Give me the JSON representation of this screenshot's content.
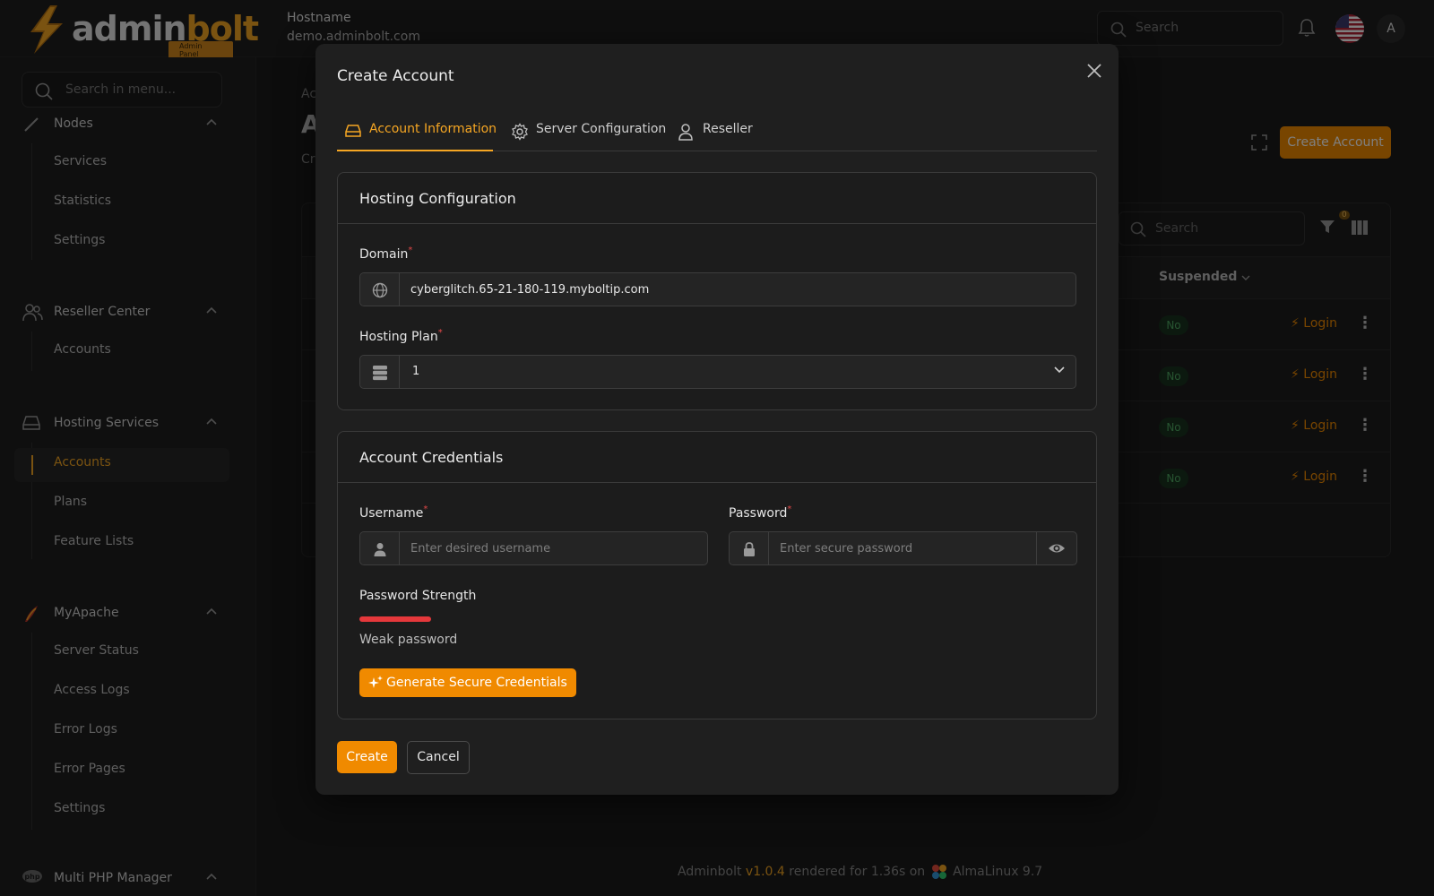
{
  "app": {
    "logo_admin": "admin",
    "logo_bolt": "bolt",
    "logo_badge": "Admin Panel",
    "hostname_label": "Hostname",
    "hostname_value": "demo.adminbolt.com",
    "search_placeholder": "Search",
    "avatar_initial": "A",
    "footer_brand": "Adminbolt",
    "footer_version": "v1.0.4",
    "footer_rendered": "rendered for 1.36s on",
    "footer_os": "AlmaLinux 9.7"
  },
  "sidebar": {
    "search_placeholder": "Search in menu...",
    "nodes_label": "Nodes",
    "nodes_items": [
      "Services",
      "Statistics",
      "Settings"
    ],
    "reseller_label": "Reseller Center",
    "reseller_items": [
      "Accounts"
    ],
    "hosting_label": "Hosting Services",
    "hosting_items": [
      "Accounts",
      "Plans",
      "Feature Lists"
    ],
    "myapache_label": "MyApache",
    "myapache_items": [
      "Server Status",
      "Access Logs",
      "Error Logs",
      "Error Pages",
      "Settings"
    ],
    "multiphp_label": "Multi PHP Manager"
  },
  "background": {
    "breadcrumb": "Ac",
    "heading": "A",
    "subtitle": "Cr",
    "create_button": "Create Account",
    "table_search_placeholder": "Search",
    "filter_count": "0",
    "col_suspended": "Suspended",
    "rows": [
      {
        "suspended": "No",
        "action": "Login"
      },
      {
        "suspended": "No",
        "action": "Login"
      },
      {
        "suspended": "No",
        "action": "Login"
      },
      {
        "suspended": "No",
        "action": "Login"
      }
    ]
  },
  "modal": {
    "title": "Create Account",
    "tabs": [
      {
        "label": "Account Information",
        "active": true,
        "icon": "drive-icon"
      },
      {
        "label": "Server Configuration",
        "active": false,
        "icon": "gear-icon"
      },
      {
        "label": "Reseller",
        "active": false,
        "icon": "user-icon"
      }
    ],
    "hosting": {
      "title": "Hosting Configuration",
      "domain_label": "Domain",
      "domain_value": "cyberglitch.65-21-180-119.myboltip.com",
      "plan_label": "Hosting Plan",
      "plan_value": "1"
    },
    "credentials": {
      "title": "Account Credentials",
      "username_label": "Username",
      "username_placeholder": "Enter desired username",
      "password_label": "Password",
      "password_placeholder": "Enter secure password",
      "strength_label": "Password Strength",
      "strength_fraction": 0.1,
      "strength_text": "Weak password",
      "generate_label": "Generate Secure Credentials"
    },
    "create_label": "Create",
    "cancel_label": "Cancel"
  },
  "colors": {
    "accent": "#f08a00",
    "danger": "#e5383b"
  }
}
